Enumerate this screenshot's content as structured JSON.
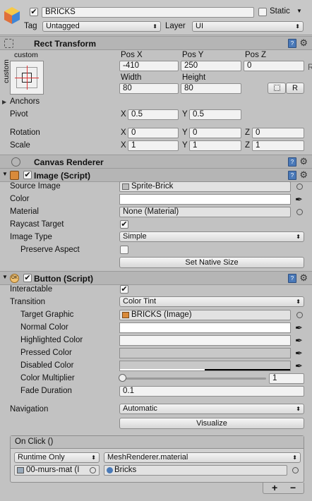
{
  "header": {
    "name": "BRICKS",
    "active_checked": true,
    "static_label": "Static",
    "tag_label": "Tag",
    "tag_value": "Untagged",
    "layer_label": "Layer",
    "layer_value": "UI"
  },
  "rect_transform": {
    "title": "Rect Transform",
    "anchor_top_label": "custom",
    "anchor_side_label": "custom",
    "posx_label": "Pos X",
    "posy_label": "Pos Y",
    "posz_label": "Pos Z",
    "posx": "-410",
    "posy": "250",
    "posz": "0",
    "width_label": "Width",
    "height_label": "Height",
    "width": "80",
    "height": "80",
    "r_button": "R",
    "edge_letter": "R",
    "anchors_label": "Anchors",
    "pivot_label": "Pivot",
    "pivot_x": "0.5",
    "pivot_y": "0.5",
    "rotation_label": "Rotation",
    "rotation_x": "0",
    "rotation_y": "0",
    "rotation_z": "0",
    "scale_label": "Scale",
    "scale_x": "1",
    "scale_y": "1",
    "scale_z": "1",
    "axis_x": "X",
    "axis_y": "Y",
    "axis_z": "Z"
  },
  "canvas_renderer": {
    "title": "Canvas Renderer"
  },
  "image_script": {
    "title": "Image (Script)",
    "enabled": true,
    "source_image_label": "Source Image",
    "source_image_value": "Sprite-Brick",
    "color_label": "Color",
    "material_label": "Material",
    "material_value": "None (Material)",
    "raycast_label": "Raycast Target",
    "raycast_checked": true,
    "image_type_label": "Image Type",
    "image_type_value": "Simple",
    "preserve_label": "Preserve Aspect",
    "preserve_checked": false,
    "native_size_button": "Set Native Size"
  },
  "button_script": {
    "title": "Button (Script)",
    "enabled": true,
    "interactable_label": "Interactable",
    "interactable_checked": true,
    "transition_label": "Transition",
    "transition_value": "Color Tint",
    "target_graphic_label": "Target Graphic",
    "target_graphic_value": "BRICKS (Image)",
    "normal_color_label": "Normal Color",
    "highlighted_color_label": "Highlighted Color",
    "pressed_color_label": "Pressed Color",
    "disabled_color_label": "Disabled Color",
    "color_multiplier_label": "Color Multiplier",
    "color_multiplier_value": "1",
    "color_multiplier_fraction": 0,
    "fade_duration_label": "Fade Duration",
    "fade_duration_value": "0.1",
    "navigation_label": "Navigation",
    "navigation_value": "Automatic",
    "visualize_button": "Visualize"
  },
  "on_click": {
    "title": "On Click ()",
    "runtime_value": "Runtime Only",
    "function_value": "MeshRenderer.material",
    "object_value": "00-murs-mat (I",
    "argument_value": "Bricks",
    "plus_label": "+",
    "minus_label": "−"
  },
  "colors": {
    "normal": "#ffffff",
    "highlighted": "#f5f5f5",
    "pressed": "#c8c8c8",
    "disabled": "#c8c8c8"
  }
}
